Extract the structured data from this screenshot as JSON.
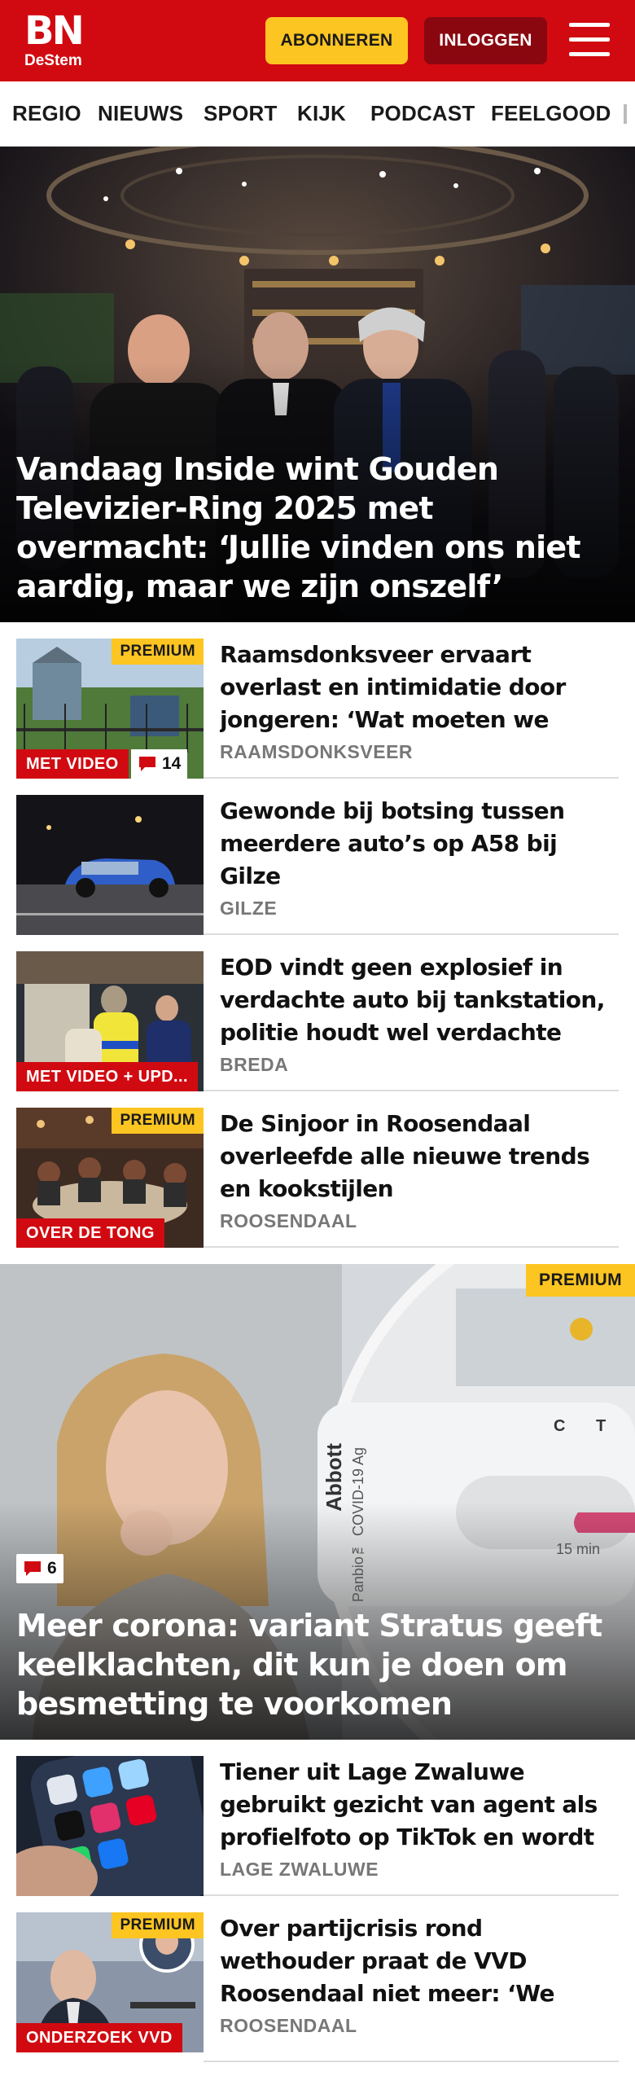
{
  "header": {
    "logo_main": "BN",
    "logo_sub": "DeStem",
    "subscribe_label": "ABONNEREN",
    "login_label": "INLOGGEN",
    "brand_color": "#d10a11",
    "accent_color": "#fcc521"
  },
  "nav": {
    "items": [
      "REGIO",
      "NIEUWS",
      "SPORT",
      "KIJK",
      "PODCAST",
      "FEELGOOD"
    ]
  },
  "hero": {
    "title": "Vandaag Inside wint Gouden Televizier-Ring 2025 met overmacht: ‘Jullie vinden ons niet aardig, maar we zijn onszelf’"
  },
  "articles": [
    {
      "title": "Raamsdonksveer ervaart overlast en intimidatie door jongeren: ‘Wat moeten we tege...",
      "location": "RAAMSDONKSVEER",
      "premium": "PREMIUM",
      "label": "MET VIDEO",
      "comments": "14"
    },
    {
      "title": "Gewonde bij botsing tussen meerdere auto’s op A58 bij Gilze",
      "location": "GILZE"
    },
    {
      "title": "EOD vindt geen explosief in verdachte auto bij tankstation, politie houdt wel verdachte aan...",
      "location": "BREDA",
      "label": "MET VIDEO + UPD..."
    },
    {
      "title": "De Sinjoor in Roosendaal overleefde alle nieuwe trends en kookstijlen",
      "location": "ROOSENDAAL",
      "premium": "PREMIUM",
      "label": "OVER DE TONG"
    }
  ],
  "feature": {
    "title": "Meer corona: variant Stratus geeft keelklachten, dit kun je doen om besmetting te voorkomen",
    "premium": "PREMIUM",
    "comments": "6",
    "test_brand": "Abbott",
    "test_name": "Panbio™ COVID-19 Ag",
    "test_marks": [
      "C",
      "T"
    ],
    "test_time": "15 min"
  },
  "articles2": [
    {
      "title": "Tiener uit Lage Zwaluwe gebruikt gezicht van agent als profielfoto op TikTok en wordt opgepakt",
      "location": "LAGE ZWALUWE"
    },
    {
      "title": "Over partijcrisis rond wethouder praat de VVD Roosendaal niet meer: ‘We willen graag vooruit’",
      "location": "ROOSENDAAL",
      "premium": "PREMIUM",
      "label": "ONDERZOEK VVD"
    }
  ]
}
